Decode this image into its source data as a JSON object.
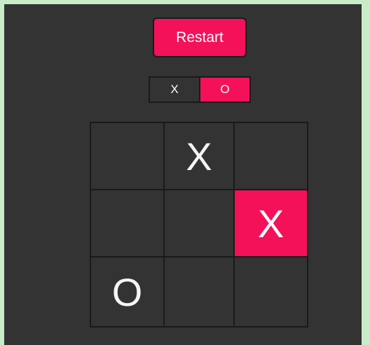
{
  "colors": {
    "accent": "#f4115a",
    "panel": "#333333",
    "outer_background": "#c8ecc8",
    "grid_line": "#1a1a1a",
    "mark_text": "#f5f5f5"
  },
  "controls": {
    "restart_label": "Restart"
  },
  "turn_indicator": {
    "x_label": "X",
    "o_label": "O",
    "active": "O"
  },
  "board": {
    "cells": [
      {
        "mark": ""
      },
      {
        "mark": "X"
      },
      {
        "mark": ""
      },
      {
        "mark": ""
      },
      {
        "mark": ""
      },
      {
        "mark": "X",
        "highlighted": true
      },
      {
        "mark": "O"
      },
      {
        "mark": ""
      },
      {
        "mark": ""
      }
    ]
  }
}
